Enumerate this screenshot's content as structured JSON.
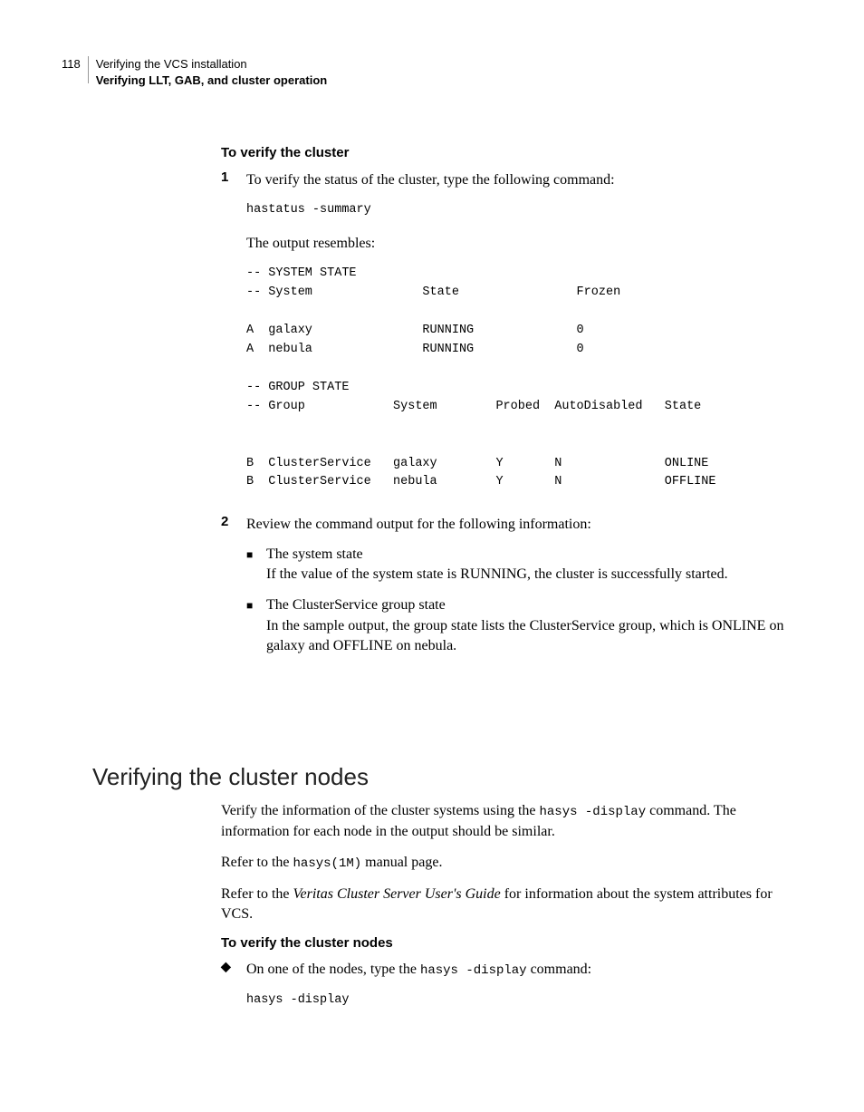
{
  "header": {
    "page_num": "118",
    "line1": "Verifying the VCS installation",
    "line2": "Verifying LLT, GAB, and cluster operation"
  },
  "sec1": {
    "title": "To verify the cluster",
    "step1": {
      "num": "1",
      "text": "To verify the status of the cluster, type the following command:",
      "cmd": "hastatus -summary",
      "resembles": "The output resembles:",
      "output": "-- SYSTEM STATE\n-- System               State                Frozen\n\nA  galaxy               RUNNING              0\nA  nebula               RUNNING              0\n\n-- GROUP STATE\n-- Group            System        Probed  AutoDisabled   State\n\n\nB  ClusterService   galaxy        Y       N              ONLINE\nB  ClusterService   nebula        Y       N              OFFLINE"
    },
    "step2": {
      "num": "2",
      "text": "Review the command output for the following information:",
      "b1_t": "The system state",
      "b1_d": "If the value of the system state is RUNNING, the cluster is successfully started.",
      "b2_t": "The ClusterService group state",
      "b2_d": "In the sample output, the group state lists the ClusterService group, which is ONLINE on galaxy and OFFLINE on nebula."
    }
  },
  "h2": "Verifying the cluster nodes",
  "sec2": {
    "p1a": "Verify the information of the cluster systems using the ",
    "p1b": "hasys -display",
    "p1c": " command. The information for each node in the output should be similar.",
    "p2a": "Refer to the ",
    "p2b": "hasys(1M)",
    "p2c": " manual page.",
    "p3a": "Refer to the ",
    "p3b": "Veritas Cluster Server User's Guide",
    "p3c": " for information about the system attributes for VCS.",
    "t2": "To verify the cluster nodes",
    "b_a": "On one of the nodes, type the ",
    "b_b": "hasys -display",
    "b_c": " command:",
    "cmd": "hasys -display"
  }
}
